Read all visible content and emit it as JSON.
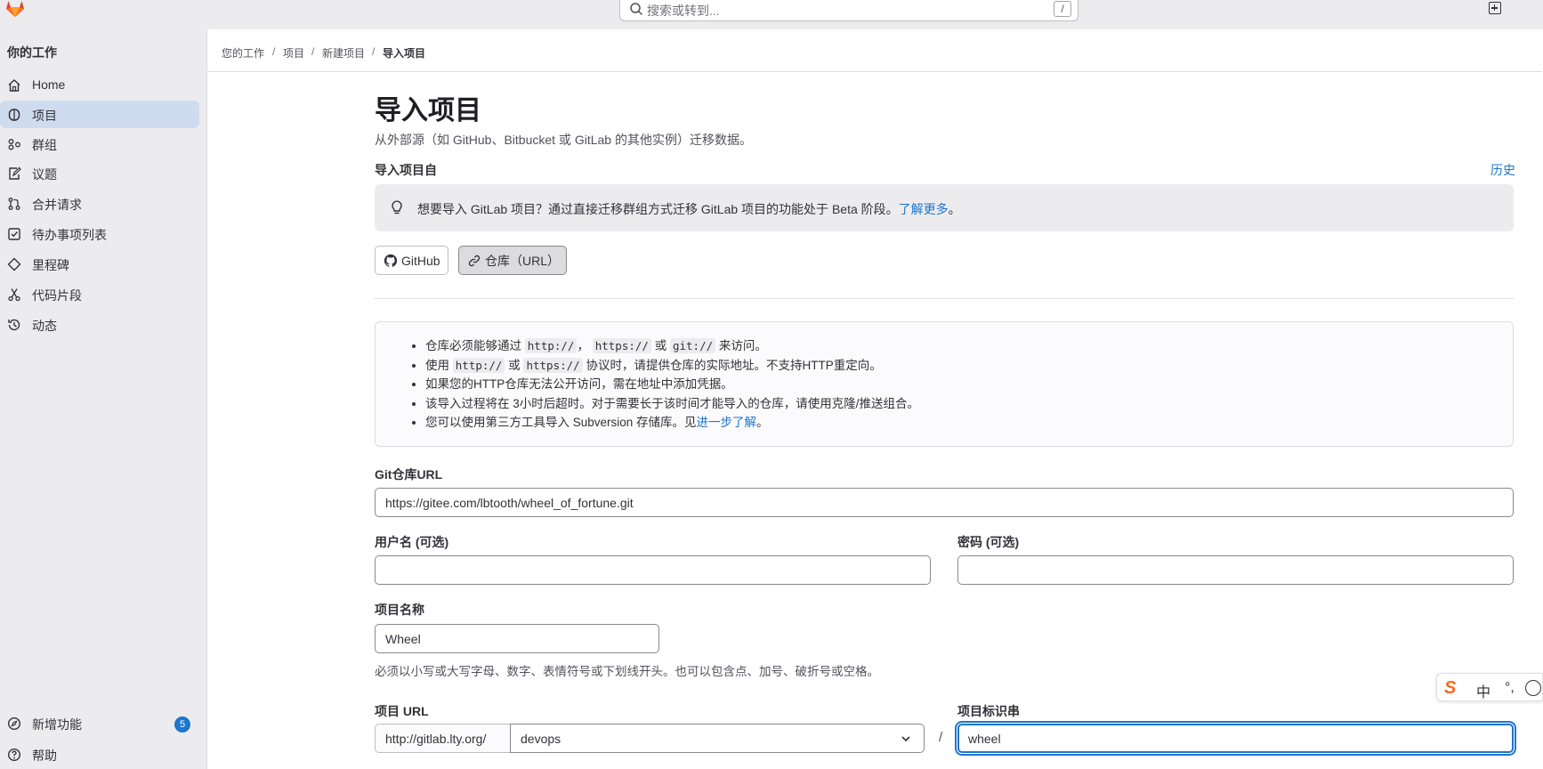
{
  "search": {
    "placeholder": "搜索或转到...",
    "shortcut": "/"
  },
  "sidebar": {
    "title": "你的工作",
    "items": [
      {
        "label": "Home",
        "icon": "home-icon",
        "active": false
      },
      {
        "label": "项目",
        "icon": "project-icon",
        "active": true
      },
      {
        "label": "群组",
        "icon": "group-icon",
        "active": false
      },
      {
        "label": "议题",
        "icon": "issues-icon",
        "active": false
      },
      {
        "label": "合并请求",
        "icon": "merge-request-icon",
        "active": false
      },
      {
        "label": "待办事项列表",
        "icon": "todo-icon",
        "active": false
      },
      {
        "label": "里程碑",
        "icon": "milestone-icon",
        "active": false
      },
      {
        "label": "代码片段",
        "icon": "snippet-icon",
        "active": false
      },
      {
        "label": "动态",
        "icon": "history-icon",
        "active": false
      }
    ],
    "bottom": [
      {
        "label": "新增功能",
        "icon": "compass-icon",
        "badge": "5"
      },
      {
        "label": "帮助",
        "icon": "help-icon"
      }
    ]
  },
  "breadcrumbs": [
    "您的工作",
    "项目",
    "新建项目",
    "导入项目"
  ],
  "page": {
    "title": "导入项目",
    "subtitle": "从外部源（如 GitHub、Bitbucket 或 GitLab 的其他实例）迁移数据。",
    "import_from_label": "导入项目自",
    "history_link": "历史",
    "alert": {
      "text": "想要导入 GitLab 项目？通过直接迁移群组方式迁移 GitLab 项目的功能处于 Beta 阶段。",
      "link": "了解更多",
      "suffix": "。"
    },
    "sources": [
      {
        "label": "GitHub",
        "icon": "github-icon",
        "selected": false
      },
      {
        "label": "仓库（URL）",
        "icon": "link-icon",
        "selected": true
      }
    ],
    "info": {
      "l1_a": "仓库必须能够通过",
      "l1_c1": "http://",
      "l1_b": "，",
      "l1_c2": "https://",
      "l1_d": "或",
      "l1_c3": "git://",
      "l1_e": "来访问。",
      "l2_a": "使用",
      "l2_c1": "http://",
      "l2_b": "或",
      "l2_c2": "https://",
      "l2_e": "协议时，请提供仓库的实际地址。不支持HTTP重定向。",
      "l3": "如果您的HTTP仓库无法公开访问，需在地址中添加凭据。",
      "l4": "该导入过程将在 3小时后超时。对于需要长于该时间才能导入的仓库，请使用克隆/推送组合。",
      "l5_a": "您可以使用第三方工具导入 Subversion 存储库。见",
      "l5_link": "进一步了解",
      "l5_b": "。"
    },
    "git_url": {
      "label": "Git仓库URL",
      "value": "https://gitee.com/lbtooth/wheel_of_fortune.git"
    },
    "username": {
      "label": "用户名 (可选)",
      "value": ""
    },
    "password": {
      "label": "密码 (可选)",
      "value": ""
    },
    "project_name": {
      "label": "项目名称",
      "value": "Wheel",
      "help": "必须以小写或大写字母、数字、表情符号或下划线开头。也可以包含点、加号、破折号或空格。"
    },
    "project_url": {
      "label": "项目 URL",
      "prefix": "http://gitlab.lty.org/",
      "namespace": "devops",
      "separator": "/"
    },
    "project_slug": {
      "label": "项目标识串",
      "value": "wheel"
    }
  },
  "ime": {
    "logo": "S",
    "mode": "中",
    "punct": "°,"
  }
}
